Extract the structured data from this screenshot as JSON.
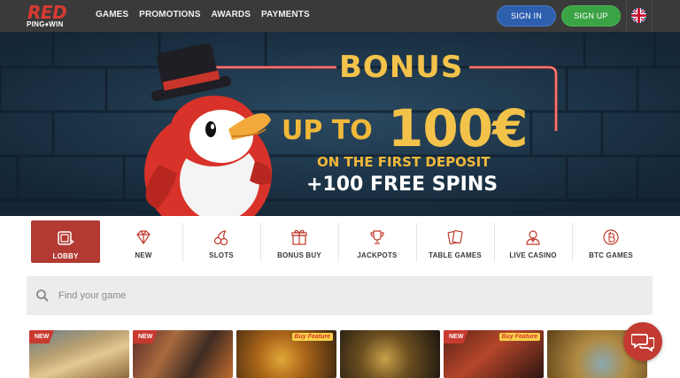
{
  "header": {
    "logo_main": "RED",
    "logo_sub": "PING♦WIN",
    "nav": [
      "GAMES",
      "PROMOTIONS",
      "AWARDS",
      "PAYMENTS"
    ],
    "sign_in": "SIGN IN",
    "sign_up": "SIGN UP",
    "language_icon": "uk-flag-icon"
  },
  "banner": {
    "headline": "BONUS",
    "up_to": "UP TO",
    "amount": "100€",
    "condition": "ON THE FIRST DEPOSIT",
    "spins": "+100 FREE SPINS"
  },
  "categories": [
    {
      "label": "LOBBY",
      "icon": "lobby-icon",
      "active": true
    },
    {
      "label": "NEW",
      "icon": "diamond-icon",
      "active": false
    },
    {
      "label": "SLOTS",
      "icon": "cherries-icon",
      "active": false
    },
    {
      "label": "BONUS BUY",
      "icon": "gift-icon",
      "active": false
    },
    {
      "label": "JACKPOTS",
      "icon": "trophy-icon",
      "active": false
    },
    {
      "label": "TABLE GAMES",
      "icon": "cards-icon",
      "active": false
    },
    {
      "label": "LIVE CASINO",
      "icon": "dealer-icon",
      "active": false
    },
    {
      "label": "BTC GAMES",
      "icon": "bitcoin-icon",
      "active": false
    }
  ],
  "search": {
    "placeholder": "Find your game"
  },
  "tiles": [
    {
      "badge": "NEW"
    },
    {
      "badge": "NEW"
    },
    {
      "badge": "Buy Feature"
    },
    {
      "badge": ""
    },
    {
      "badge": "NEW",
      "badge2": "Buy Feature"
    },
    {
      "badge": ""
    }
  ],
  "colors": {
    "header_bg": "#3a3a3a",
    "brand_red": "#b23a33",
    "sign_in_blue": "#2d5fae",
    "sign_up_green": "#3aa344",
    "bonus_gold": "#f3c24a"
  },
  "chat_icon": "chat-bubbles-icon"
}
